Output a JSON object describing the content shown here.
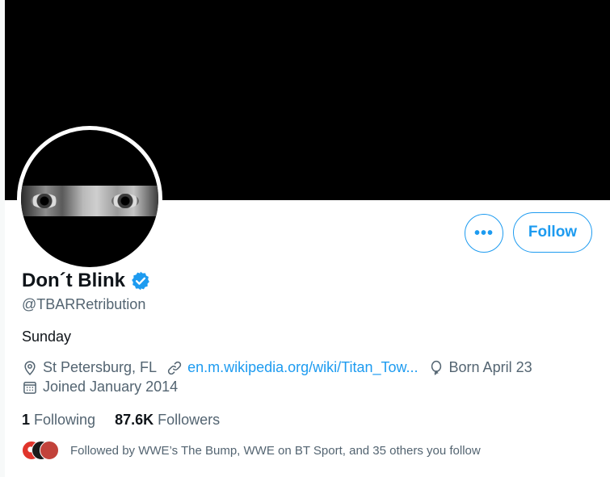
{
  "profile": {
    "display_name": "Don´t Blink",
    "verified": true,
    "handle": "@TBARRetribution",
    "bio": "Sunday",
    "location": "St Petersburg, FL",
    "website": "en.m.wikipedia.org/wiki/Titan_Tow...",
    "birthday": "Born April 23",
    "joined": "Joined January 2014"
  },
  "actions": {
    "more_label": "•••",
    "follow_label": "Follow"
  },
  "stats": {
    "following_count": "1",
    "following_label": "Following",
    "followers_count": "87.6K",
    "followers_label": "Followers"
  },
  "followed_by": "Followed by WWE’s The Bump, WWE on BT Sport, and 35 others you follow",
  "colors": {
    "accent": "#1d9bf0",
    "secondary_text": "#536471",
    "primary_text": "#0f1419"
  },
  "icons": [
    "location-icon",
    "link-icon",
    "balloon-icon",
    "calendar-icon",
    "verified-badge-icon",
    "more-icon"
  ]
}
